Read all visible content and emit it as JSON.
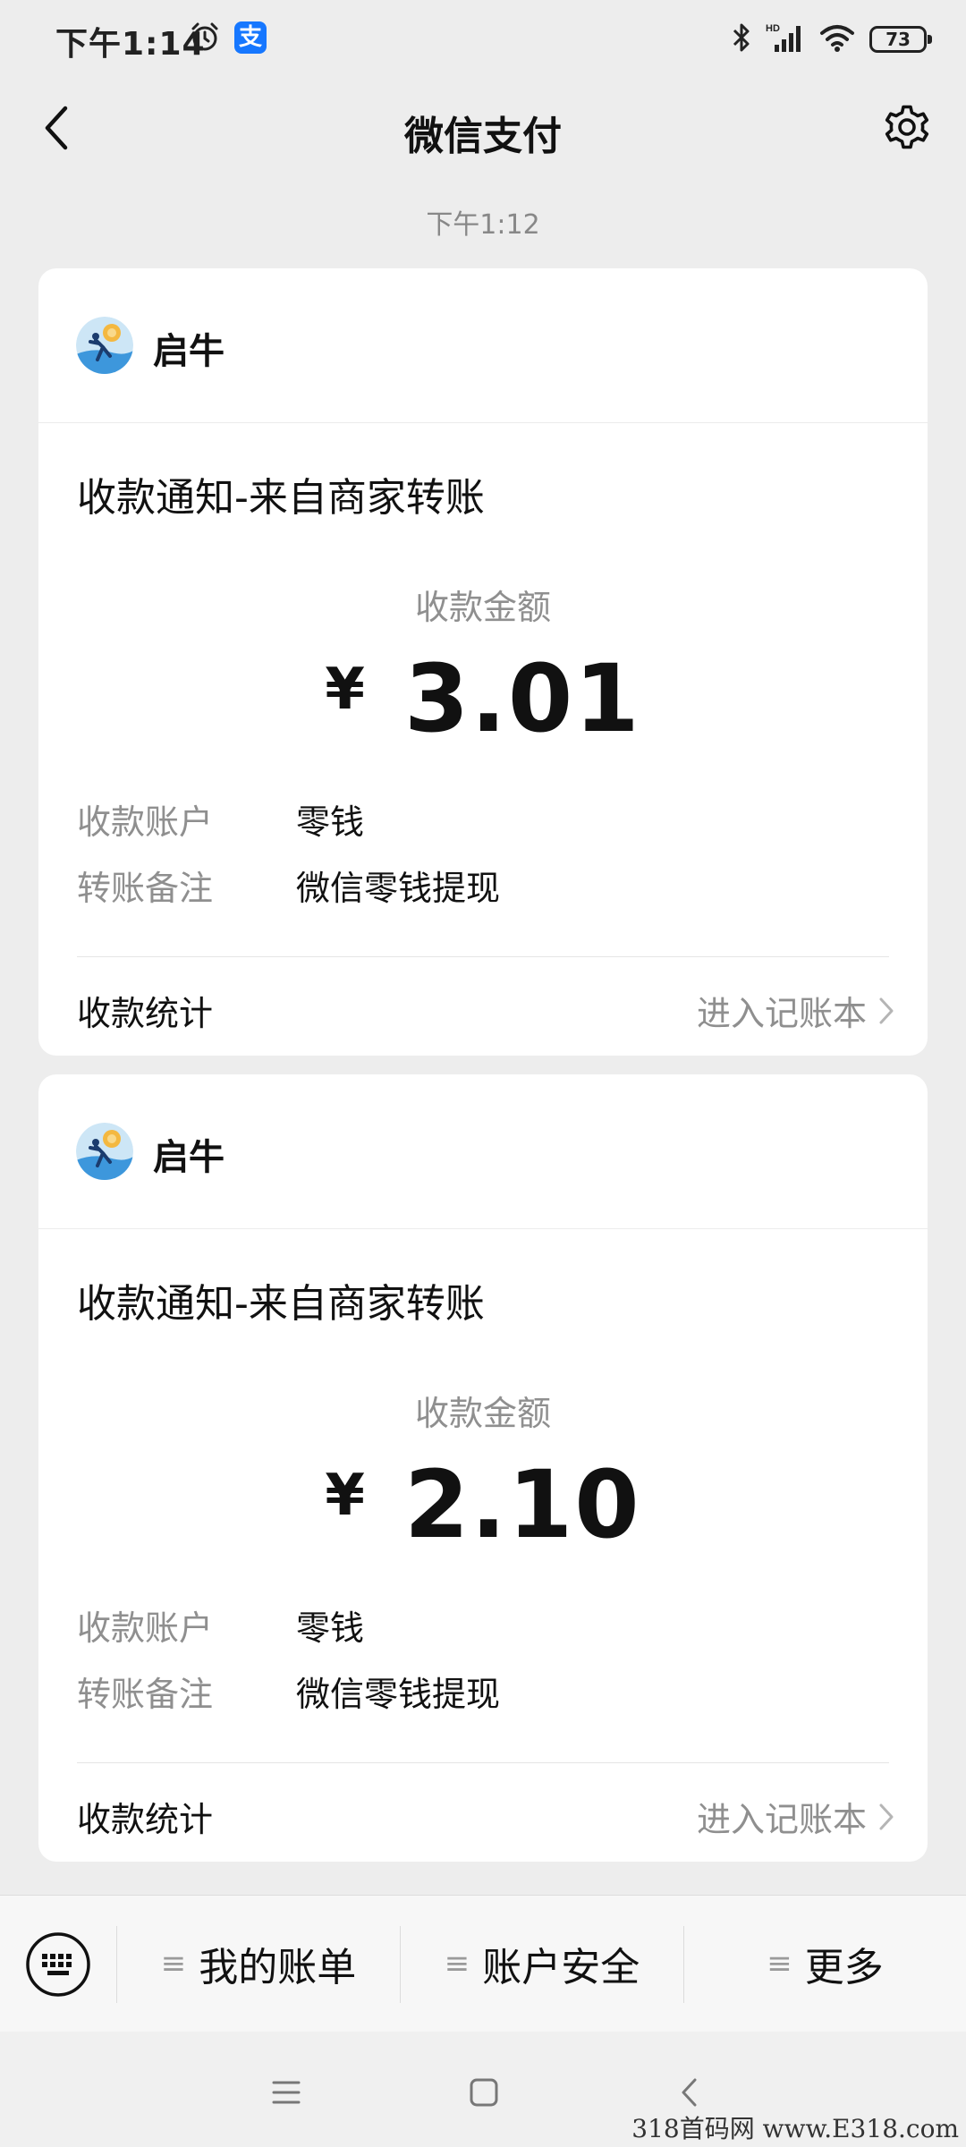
{
  "status_bar": {
    "time": "下午1:14",
    "alipay_glyph": "支",
    "battery_level": "73",
    "icons": [
      "alarm-icon",
      "alipay-icon",
      "bluetooth-icon",
      "signal-icon",
      "wifi-icon",
      "battery-icon"
    ]
  },
  "header": {
    "title": "微信支付",
    "back_icon": "back-arrow-icon",
    "settings_icon": "gear-icon"
  },
  "timestamp": "下午1:12",
  "cards": [
    {
      "merchant": "启牛",
      "title": "收款通知-来自商家转账",
      "amount_label": "收款金额",
      "currency": "¥",
      "amount": "3.01",
      "details": [
        {
          "label": "收款账户",
          "value": "零钱"
        },
        {
          "label": "转账备注",
          "value": "微信零钱提现"
        }
      ],
      "stats_label": "收款统计",
      "stats_link": "进入记账本"
    },
    {
      "merchant": "启牛",
      "title": "收款通知-来自商家转账",
      "amount_label": "收款金额",
      "currency": "¥",
      "amount": "2.10",
      "details": [
        {
          "label": "收款账户",
          "value": "零钱"
        },
        {
          "label": "转账备注",
          "value": "微信零钱提现"
        }
      ],
      "stats_label": "收款统计",
      "stats_link": "进入记账本"
    }
  ],
  "bottom_menu": {
    "keyboard_icon": "keyboard-icon",
    "items": [
      {
        "label": "我的账单"
      },
      {
        "label": "账户安全"
      },
      {
        "label": "更多"
      }
    ]
  },
  "nav_bar": {
    "icons": [
      "menu-icon",
      "home-icon",
      "back-icon"
    ]
  },
  "watermark": "318首码网 www.E318.com",
  "colors": {
    "background": "#ededed",
    "card": "#ffffff",
    "secondary_text": "#8f8f8f",
    "alipay_blue": "#1677ff"
  }
}
